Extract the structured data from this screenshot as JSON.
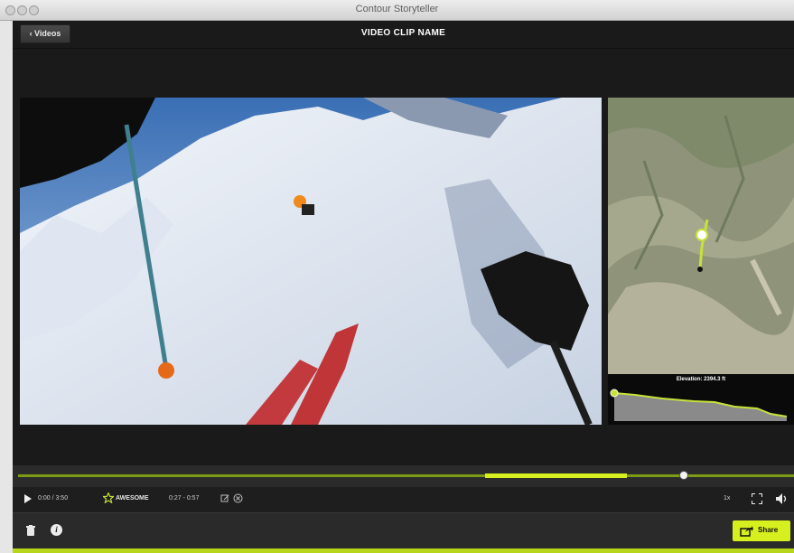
{
  "window": {
    "title": "Contour Storyteller"
  },
  "header": {
    "back_label": "‹ Videos",
    "clip_title": "VIDEO CLIP NAME"
  },
  "map": {
    "elevation_label": "Elevation: 2394.3 ft",
    "icon": "terrain-map"
  },
  "player": {
    "time": "0:00 / 3:50",
    "tag_label": "AWESOME",
    "segment_range": "0:27 - 0:57",
    "speed": "1x",
    "progress_played": 0.0,
    "highlight_start": 0.6,
    "highlight_end": 0.78,
    "playhead": 0.87
  },
  "footer": {
    "share_label": "Share"
  },
  "colors": {
    "accent": "#d6ef1f",
    "background": "#1c1c1c"
  }
}
